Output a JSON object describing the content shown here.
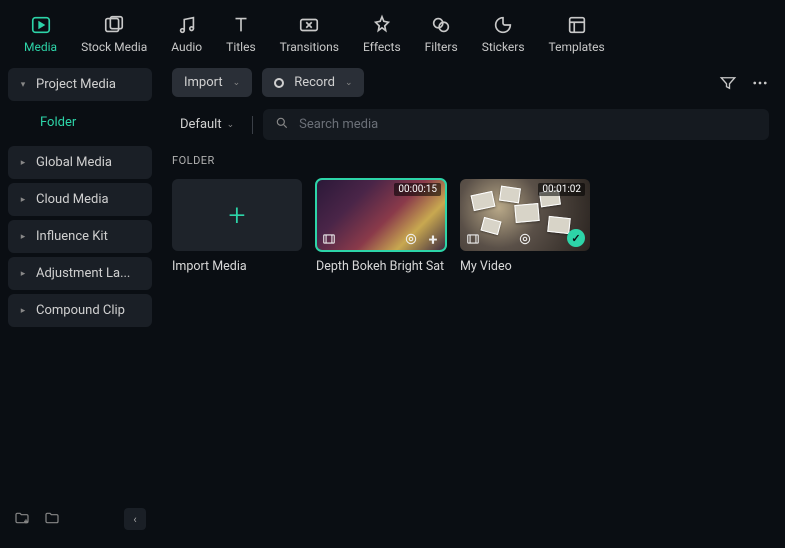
{
  "topnav": [
    {
      "label": "Media",
      "active": true
    },
    {
      "label": "Stock Media"
    },
    {
      "label": "Audio"
    },
    {
      "label": "Titles"
    },
    {
      "label": "Transitions"
    },
    {
      "label": "Effects"
    },
    {
      "label": "Filters"
    },
    {
      "label": "Stickers"
    },
    {
      "label": "Templates"
    }
  ],
  "sidebar": {
    "items": [
      {
        "label": "Project Media",
        "caret": "down",
        "sub": "Folder"
      },
      {
        "label": "Global Media",
        "caret": "right"
      },
      {
        "label": "Cloud Media",
        "caret": "right"
      },
      {
        "label": "Influence Kit",
        "caret": "right"
      },
      {
        "label": "Adjustment La...",
        "caret": "right"
      },
      {
        "label": "Compound Clip",
        "caret": "right"
      }
    ]
  },
  "toolbar": {
    "import": "Import",
    "record": "Record"
  },
  "search": {
    "sort": "Default",
    "placeholder": "Search media"
  },
  "section": "FOLDER",
  "tiles": [
    {
      "type": "import",
      "label": "Import Media"
    },
    {
      "type": "clip",
      "label": "Depth Bokeh Bright Sat",
      "duration": "00:00:15",
      "selected": true
    },
    {
      "type": "clip",
      "label": "My Video",
      "duration": "00:01:02",
      "checked": true
    }
  ]
}
